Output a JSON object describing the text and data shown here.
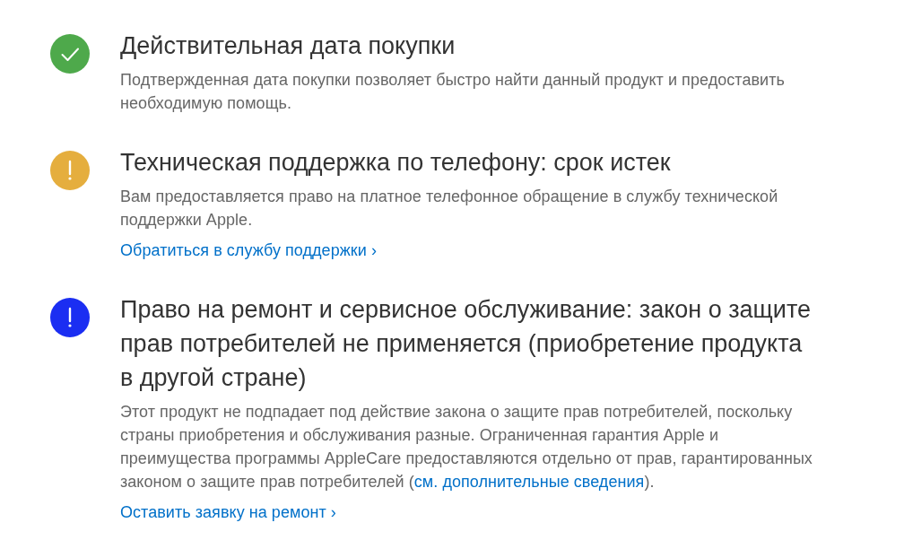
{
  "items": [
    {
      "kind": "check",
      "color": "#4ea94b",
      "title": "Действительная дата покупки",
      "description": [
        {
          "kind": "text",
          "text": "Подтвержденная дата покупки позволяет быстро найти данный продукт и предоставить необходимую помощь."
        }
      ]
    },
    {
      "kind": "alert",
      "color": "#e5ae3e",
      "title": "Техническая поддержка по телефону: срок истек",
      "description": [
        {
          "kind": "text",
          "text": "Вам предоставляется право на платное телефонное обращение в службу технической поддержки Apple."
        }
      ],
      "action": "Обратиться в службу поддержки ›"
    },
    {
      "kind": "alert",
      "color": "#1b2ef2",
      "title": "Право на ремонт и сервисное обслуживание: закон о защите прав потребителей не применяется (приобретение продукта в другой стране)",
      "description": [
        {
          "kind": "text",
          "text": "Этот продукт не подпадает под действие закона о защите прав потребителей, поскольку страны приобретения и обслуживания разные. Ограниченная гарантия Apple и преимущества программы AppleCare предоставляются отдельно от прав, гарантированных законом о защите прав потребителей ("
        },
        {
          "kind": "link",
          "text": "см. дополнительные сведения"
        },
        {
          "kind": "text",
          "text": ")."
        }
      ],
      "action": "Оставить заявку на ремонт ›"
    }
  ]
}
